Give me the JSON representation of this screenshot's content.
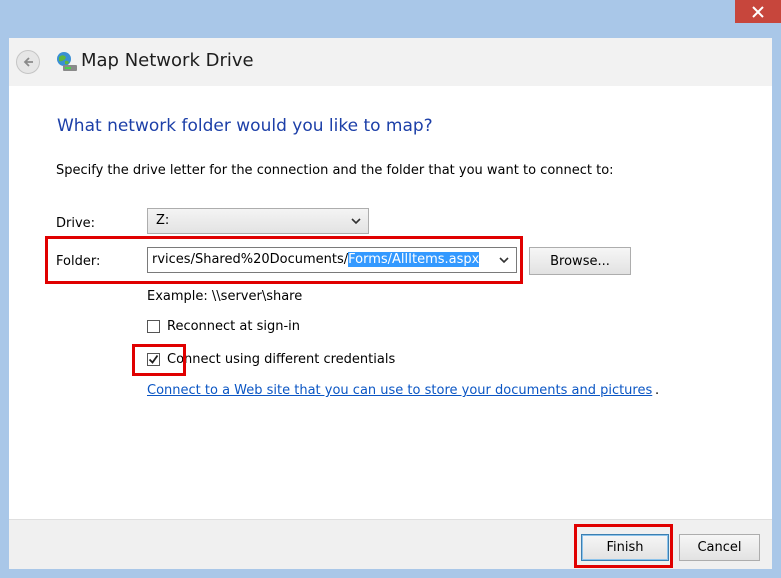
{
  "window": {
    "title": "Map Network Drive"
  },
  "icons": {
    "close": "close-icon",
    "back": "back-arrow-icon",
    "app": "network-drive-icon",
    "dropdown": "chevron-down-icon"
  },
  "content": {
    "heading": "What network folder would you like to map?",
    "instruction": "Specify the drive letter for the connection and the folder that you want to connect to:",
    "drive_label": "Drive:",
    "drive_value": "Z:",
    "folder_label": "Folder:",
    "folder_value_unselected": "rvices/Shared%20Documents/",
    "folder_value_selected": "Forms/AllItems.aspx",
    "browse_label": "Browse...",
    "example": "Example: \\\\server\\share",
    "reconnect_label": "Reconnect at sign-in",
    "reconnect_checked": false,
    "credentials_label": "Connect using different credentials",
    "credentials_checked": true,
    "link_text": "Connect to a Web site that you can use to store your documents and pictures",
    "link_suffix": "."
  },
  "footer": {
    "finish_label": "Finish",
    "cancel_label": "Cancel"
  },
  "colors": {
    "frame": "#a9c7e8",
    "close": "#c7463c",
    "heading": "#1c3fa8",
    "link": "#0b56c4",
    "selection": "#3399ff",
    "highlight": "#e00000"
  }
}
